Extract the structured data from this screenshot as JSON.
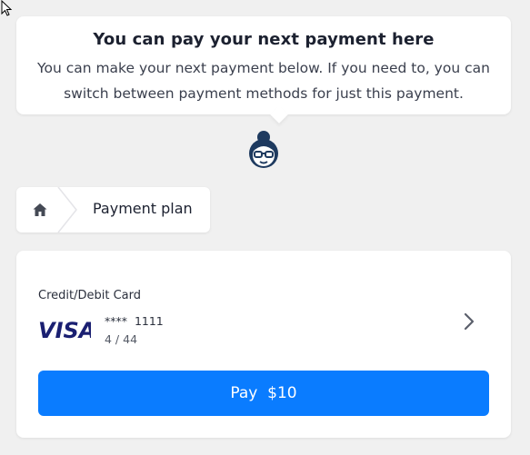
{
  "message": {
    "title": "You can pay your next payment here",
    "body": "You can make your next payment below. If you need to, you can switch between payment methods for just this payment."
  },
  "breadcrumb": {
    "current": "Payment plan"
  },
  "payment_method": {
    "title": "Credit/Debit Card",
    "brand": "VISA",
    "card_mask": "****  1111",
    "expiry": "4 / 44"
  },
  "pay_button": {
    "label": "Pay",
    "amount": "$10"
  },
  "colors": {
    "accent": "#0a7cff",
    "visa_blue": "#1a1f71"
  }
}
